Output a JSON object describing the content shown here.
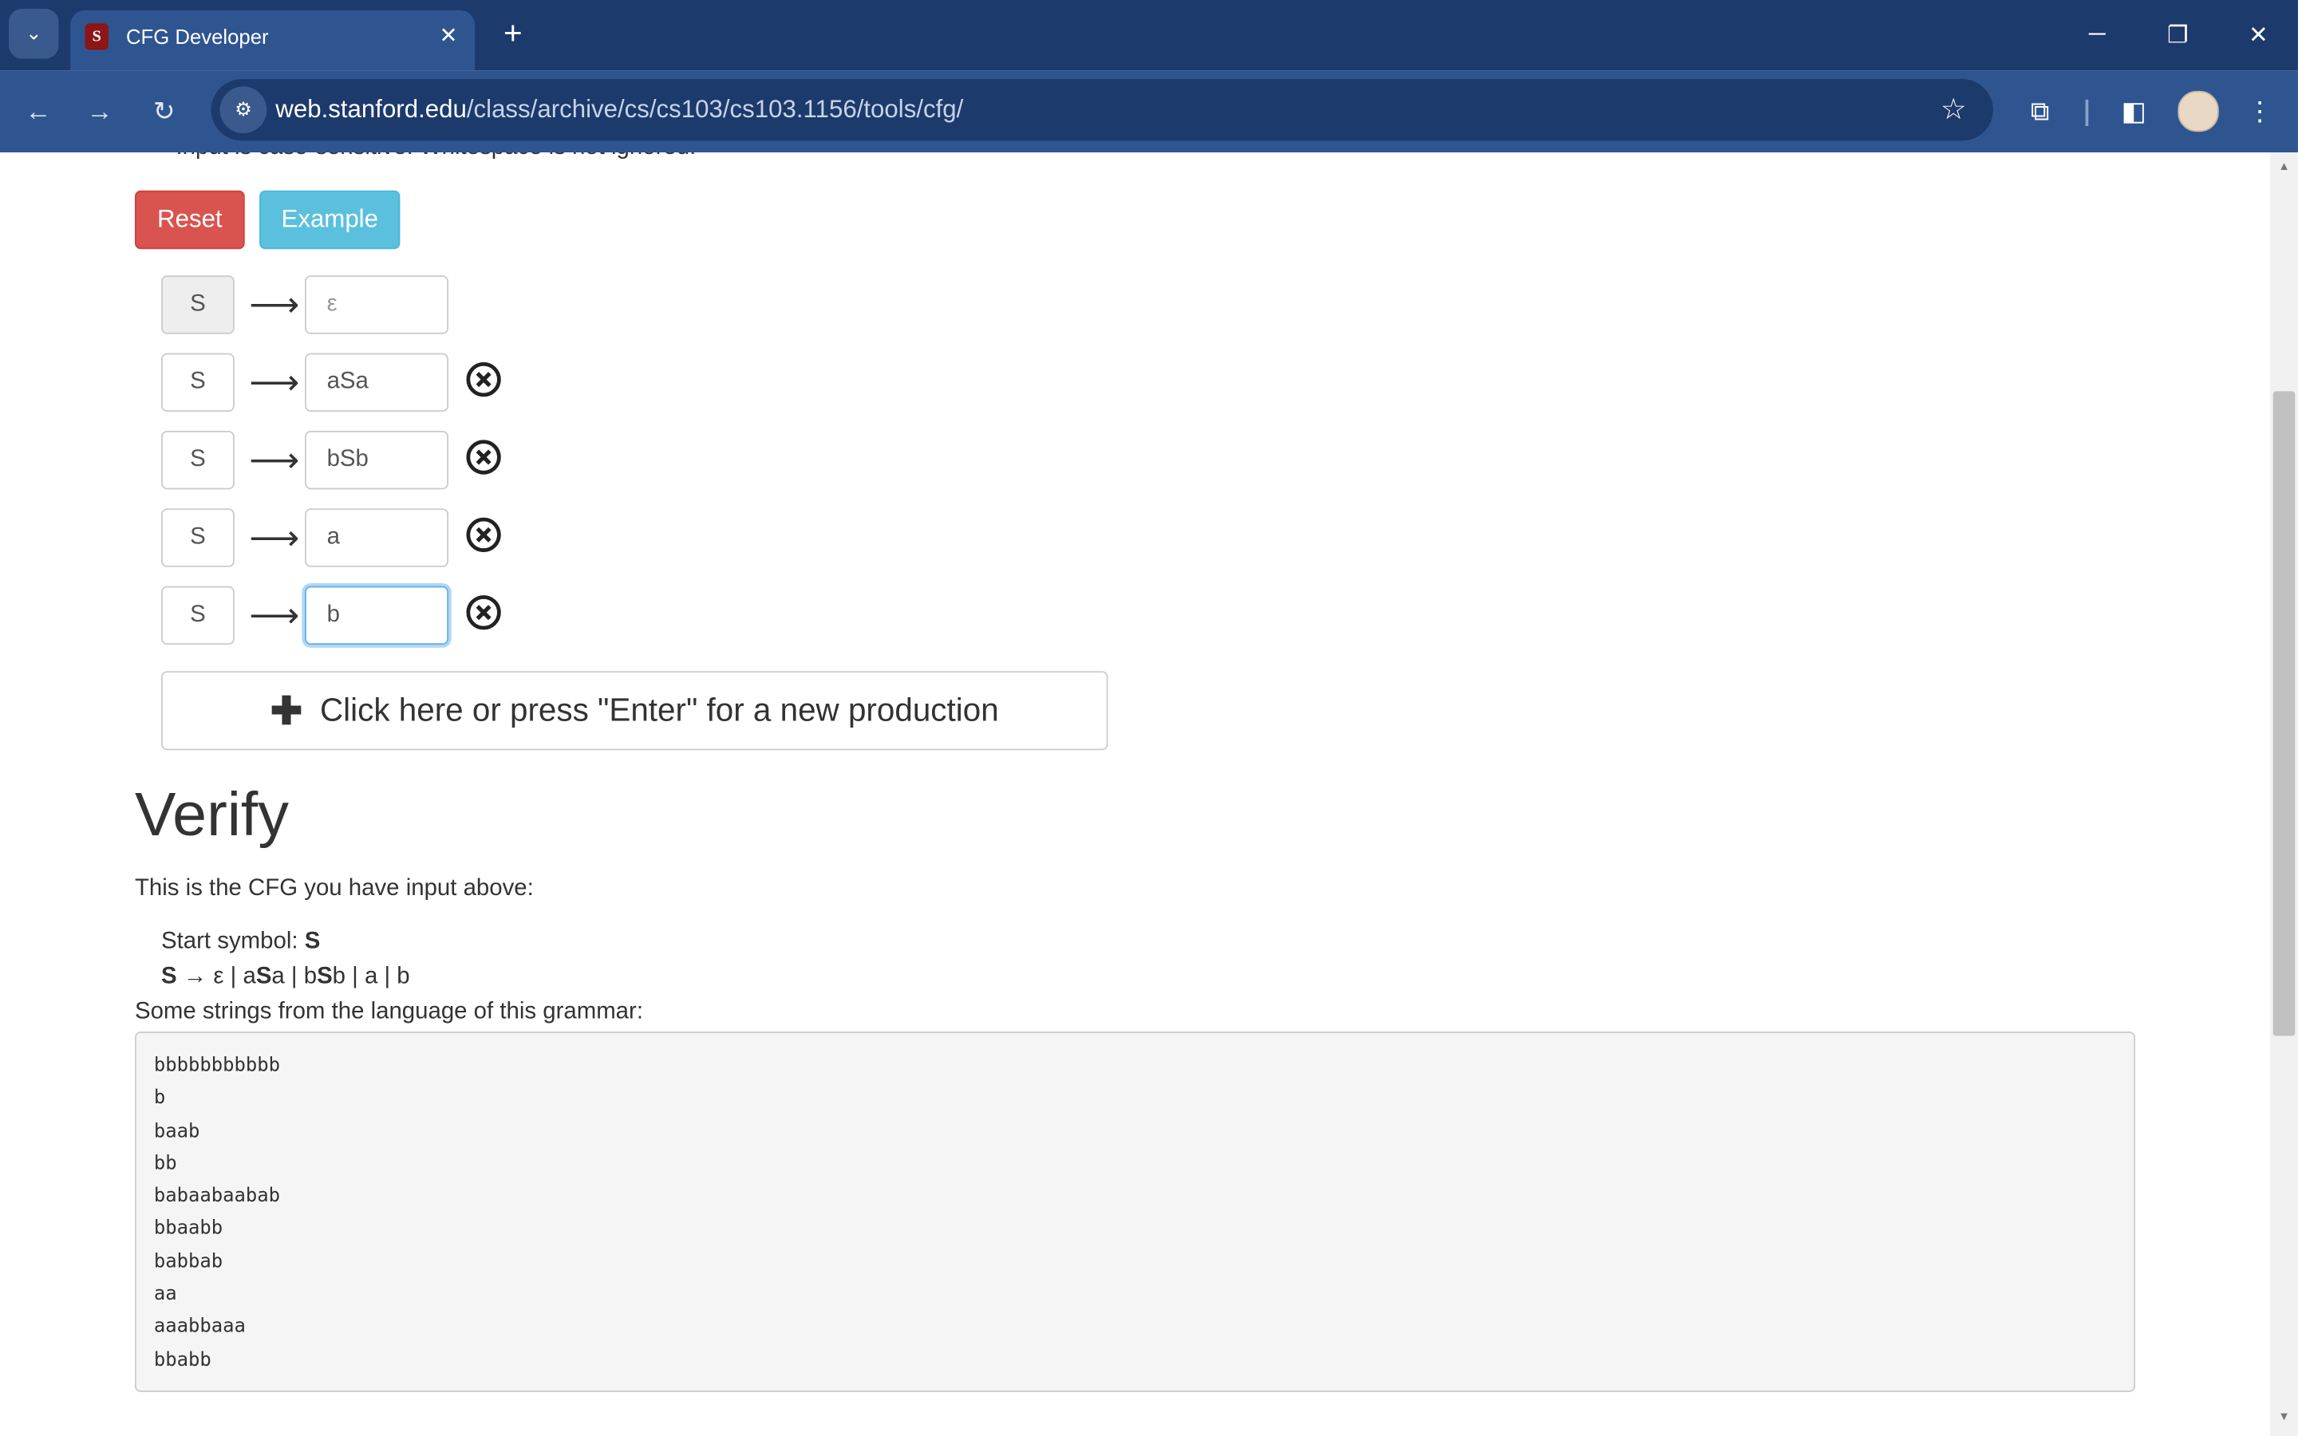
{
  "browser": {
    "tab_title": "CFG Developer",
    "url_host": "web.stanford.edu",
    "url_path": "/class/archive/cs/cs103/cs103.1156/tools/cfg/"
  },
  "page": {
    "cut_off_text": "Input is case-sensitive. Whitespace is not ignored.",
    "reset_label": "Reset",
    "example_label": "Example",
    "arrow": "⟶",
    "productions": [
      {
        "lhs": "S",
        "rhs": "ε"
      },
      {
        "lhs": "S",
        "rhs": "aSa"
      },
      {
        "lhs": "S",
        "rhs": "bSb"
      },
      {
        "lhs": "S",
        "rhs": "a"
      },
      {
        "lhs": "S",
        "rhs": "b"
      }
    ],
    "add_production_label": "Click here or press \"Enter\" for a new production",
    "verify_heading": "Verify",
    "intro_text": "This is the CFG you have input above:",
    "start_symbol_label": "Start symbol:",
    "start_symbol": "S",
    "rule_lhs": "S",
    "rule_arrow": "→",
    "rule_parts": [
      "ε",
      " | a",
      "S",
      "a | b",
      "S",
      "b | a | b"
    ],
    "some_strings_label": "Some strings from the language of this grammar:",
    "strings": [
      "bbbbbbbbbbb",
      "b",
      "baab",
      "bb",
      "babaabaabab",
      "bbaabb",
      "babbab",
      "aa",
      "aaabbaaa",
      "bbabb"
    ]
  }
}
